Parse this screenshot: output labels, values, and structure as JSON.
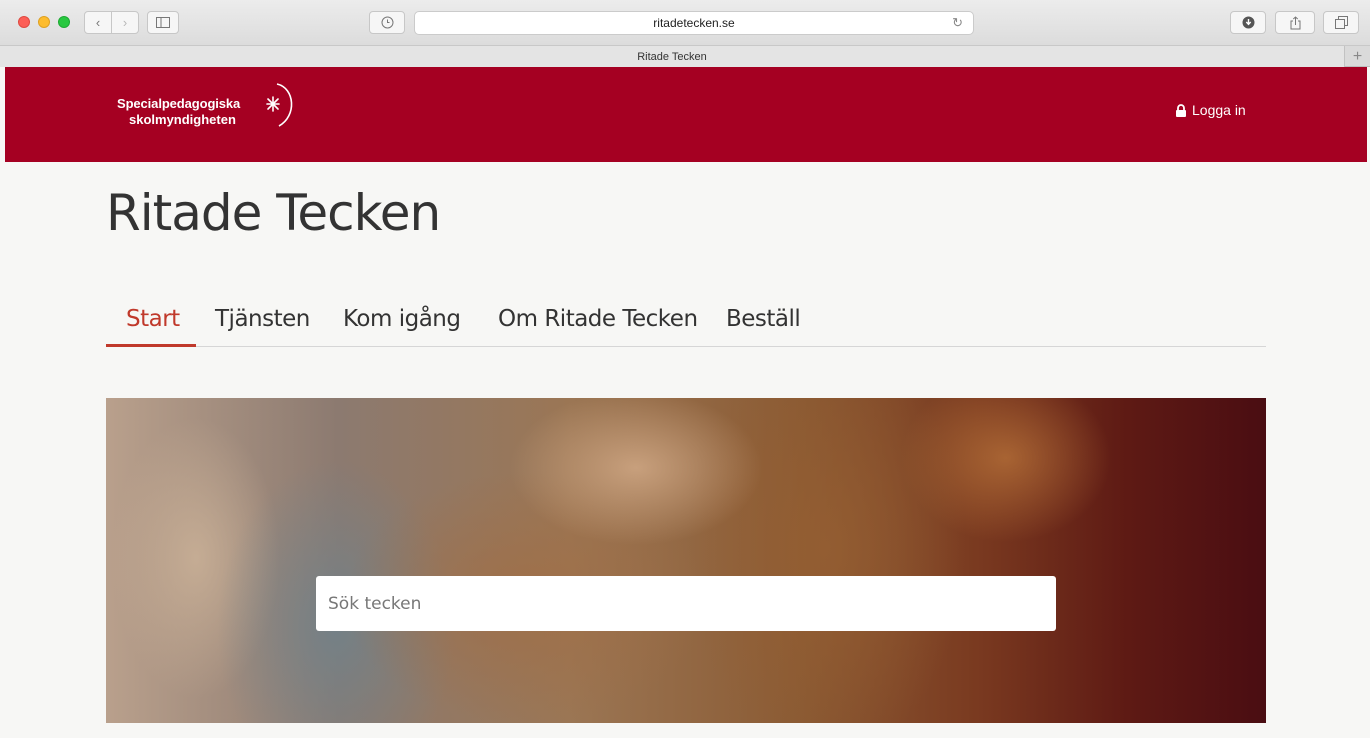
{
  "browser": {
    "url": "ritadetecken.se",
    "tab_title": "Ritade Tecken",
    "new_tab": "+"
  },
  "header": {
    "logo_line1": "Specialpedagogiska",
    "logo_line2": "skolmyndigheten",
    "login_label": "Logga in",
    "bg_color": "#a50022"
  },
  "main": {
    "title": "Ritade Tecken",
    "nav": [
      {
        "label": "Start",
        "active": true
      },
      {
        "label": "Tjänsten"
      },
      {
        "label": "Kom igång"
      },
      {
        "label": "Om Ritade Tecken"
      },
      {
        "label": "Beställ"
      }
    ],
    "accent_color": "#c0392b"
  },
  "search": {
    "placeholder": "Sök tecken"
  }
}
